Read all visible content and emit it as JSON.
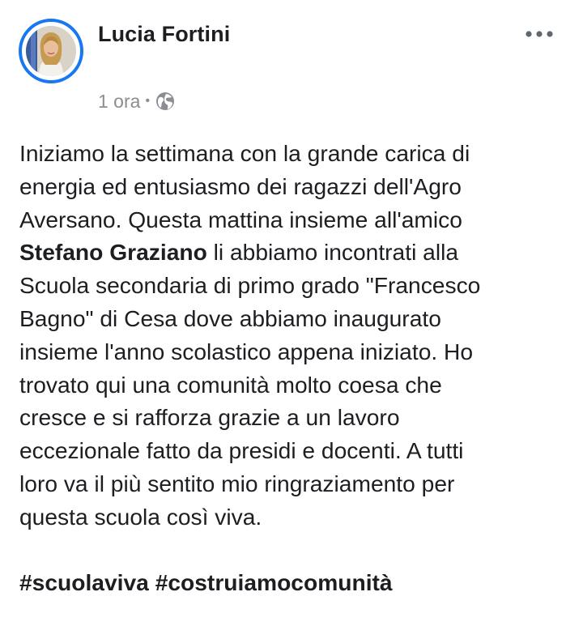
{
  "author": {
    "name": "Lucia Fortini",
    "avatar_icon": "profile-photo",
    "ring_color": "#1877f2"
  },
  "meta": {
    "time": "1 ora",
    "separator": "•",
    "privacy_icon": "globe-icon"
  },
  "menu": {
    "icon": "more-horizontal-icon"
  },
  "post": {
    "lines": [
      "Iniziamo la settimana con la grande carica di",
      "energia ed entusiasmo dei ragazzi dell'Agro",
      "Aversano. Questa mattina insieme all'amico"
    ],
    "mention": "Stefano Graziano",
    "after_mention": " li abbiamo incontrati alla",
    "rest_lines": [
      "Scuola secondaria di primo grado \"Francesco",
      "Bagno\" di Cesa dove abbiamo inaugurato",
      "insieme l'anno scolastico appena iniziato. Ho",
      "trovato qui una comunità molto coesa che",
      "cresce e si rafforza grazie a un lavoro",
      "eccezionale fatto da presidi e docenti. A tutti",
      "loro va il più sentito mio ringraziamento per",
      "questa scuola così viva."
    ],
    "hashtags": [
      "#scuolaviva",
      "#costruiamocomunità"
    ]
  }
}
